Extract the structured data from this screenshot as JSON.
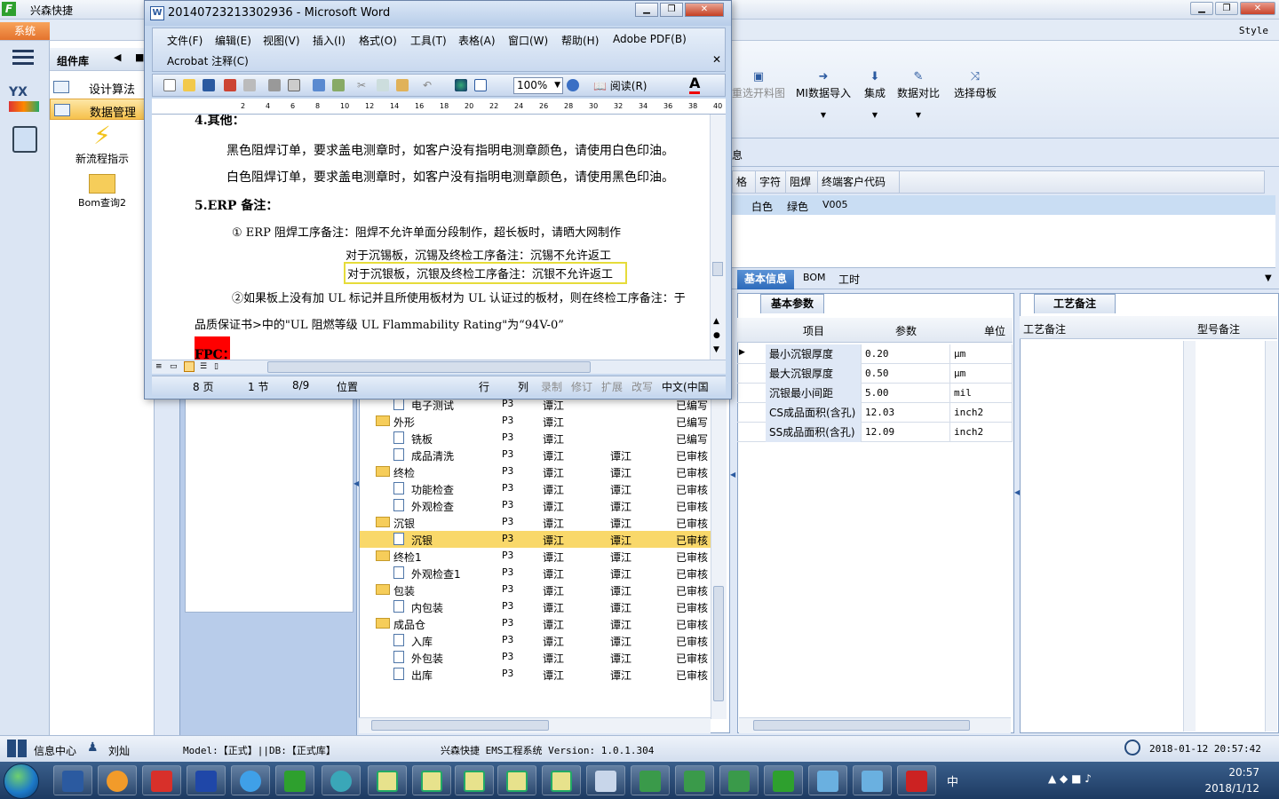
{
  "app": {
    "title": "兴森快捷",
    "logo": "F",
    "system_tab": "系统",
    "style_label": "Style"
  },
  "left_nav": {
    "panel_title": "组件库",
    "items": [
      {
        "label": "设计算法"
      },
      {
        "label": "数据管理"
      }
    ],
    "big_items": [
      {
        "label": "新流程指示"
      },
      {
        "label": "Bom查询2"
      }
    ]
  },
  "ribbon": {
    "buttons": [
      {
        "label": "重选开料图",
        "icon": "image-icon"
      },
      {
        "label": "MI数据导入",
        "icon": "import-icon"
      },
      {
        "label": "集成",
        "icon": "download-icon"
      },
      {
        "label": "数据对比",
        "icon": "compare-icon"
      },
      {
        "label": "选择母板",
        "icon": "shuffle-icon"
      }
    ]
  },
  "grid": {
    "headers": [
      "格",
      "字符",
      "阻焊",
      "终端客户代码"
    ],
    "row": [
      "白色",
      "绿色",
      "V005"
    ]
  },
  "info_tabs": [
    "基本信息",
    "BOM",
    "工时"
  ],
  "params": {
    "tab": "基本参数",
    "headers": [
      "项目",
      "参数",
      "单位"
    ],
    "rows": [
      {
        "name": "最小沉银厚度",
        "value": "0.20",
        "unit": "μm"
      },
      {
        "name": "最大沉银厚度",
        "value": "0.50",
        "unit": "μm"
      },
      {
        "name": "沉银最小间距",
        "value": "5.00",
        "unit": "mil"
      },
      {
        "name": "CS成品面积(含孔)",
        "value": "12.03",
        "unit": "inch2"
      },
      {
        "name": "SS成品面积(含孔)",
        "value": "12.09",
        "unit": "inch2"
      }
    ]
  },
  "process": {
    "tab": "工艺备注",
    "headers": [
      "工艺备注",
      "型号备注"
    ]
  },
  "tree": {
    "rows": [
      {
        "level": 1,
        "name": "电子测试",
        "c1": "P3",
        "c2": "谭江",
        "c3": "",
        "c4": "已编写"
      },
      {
        "level": 0,
        "name": "外形",
        "c1": "P3",
        "c2": "谭江",
        "c3": "",
        "c4": "已编写"
      },
      {
        "level": 1,
        "name": "铣板",
        "c1": "P3",
        "c2": "谭江",
        "c3": "",
        "c4": "已编写"
      },
      {
        "level": 1,
        "name": "成品清洗",
        "c1": "P3",
        "c2": "谭江",
        "c3": "谭江",
        "c4": "已审核"
      },
      {
        "level": 0,
        "name": "终检",
        "c1": "P3",
        "c2": "谭江",
        "c3": "谭江",
        "c4": "已审核"
      },
      {
        "level": 1,
        "name": "功能检查",
        "c1": "P3",
        "c2": "谭江",
        "c3": "谭江",
        "c4": "已审核"
      },
      {
        "level": 1,
        "name": "外观检查",
        "c1": "P3",
        "c2": "谭江",
        "c3": "谭江",
        "c4": "已审核"
      },
      {
        "level": 0,
        "name": "沉银",
        "c1": "P3",
        "c2": "谭江",
        "c3": "谭江",
        "c4": "已审核"
      },
      {
        "level": 1,
        "name": "沉银",
        "c1": "P3",
        "c2": "谭江",
        "c3": "谭江",
        "c4": "已审核",
        "selected": true
      },
      {
        "level": 0,
        "name": "终检1",
        "c1": "P3",
        "c2": "谭江",
        "c3": "谭江",
        "c4": "已审核"
      },
      {
        "level": 1,
        "name": "外观检查1",
        "c1": "P3",
        "c2": "谭江",
        "c3": "谭江",
        "c4": "已审核"
      },
      {
        "level": 0,
        "name": "包装",
        "c1": "P3",
        "c2": "谭江",
        "c3": "谭江",
        "c4": "已审核"
      },
      {
        "level": 1,
        "name": "内包装",
        "c1": "P3",
        "c2": "谭江",
        "c3": "谭江",
        "c4": "已审核"
      },
      {
        "level": 0,
        "name": "成品仓",
        "c1": "P3",
        "c2": "谭江",
        "c3": "谭江",
        "c4": "已审核"
      },
      {
        "level": 1,
        "name": "入库",
        "c1": "P3",
        "c2": "谭江",
        "c3": "谭江",
        "c4": "已审核"
      },
      {
        "level": 1,
        "name": "外包装",
        "c1": "P3",
        "c2": "谭江",
        "c3": "谭江",
        "c4": "已审核"
      },
      {
        "level": 1,
        "name": "出库",
        "c1": "P3",
        "c2": "谭江",
        "c3": "谭江",
        "c4": "已审核"
      }
    ]
  },
  "status": {
    "info_center": "信息中心",
    "user": "刘灿",
    "model": "Model:【正式】||DB:【正式库】",
    "system": "兴森快捷 EMS工程系统 Version: 1.0.1.304",
    "datetime": "2018-01-12 20:57:42"
  },
  "word": {
    "title": "20140723213302936 - Microsoft Word",
    "menu": [
      "文件(F)",
      "编辑(E)",
      "视图(V)",
      "插入(I)",
      "格式(O)",
      "工具(T)",
      "表格(A)",
      "窗口(W)",
      "帮助(H)",
      "Adobe PDF(B)"
    ],
    "menu2": "Acrobat 注释(C)",
    "zoom": "100%",
    "read_label": "阅读(R)",
    "ruler_marks": [
      "2",
      "4",
      "6",
      "8",
      "10",
      "12",
      "14",
      "16",
      "18",
      "20",
      "22",
      "24",
      "26",
      "28",
      "30",
      "32",
      "34",
      "36",
      "38",
      "40"
    ],
    "doc_lines": [
      "4.其他：",
      "黑色阻焊订单，要求盖电测章时，如客户没有指明电测章颜色，请使用白色印油。",
      "白色阻焊订单，要求盖电测章时，如客户没有指明电测章颜色，请使用黑色印油。",
      "5.ERP 备注：",
      "① ERP 阻焊工序备注：阻焊不允许单面分段制作，超长板时，请晒大网制作",
      "对于沉锡板，沉锡及终检工序备注：沉锡不允许返工",
      "对于沉银板，沉银及终检工序备注：沉银不允许返工",
      "②如果板上没有加 UL 标记并且所使用板材为 UL 认证过的板材，则在终检工序备注：于",
      "品质保证书>中的\"UL 阻燃等级 UL Flammability Rating\"为“94V-0”",
      "FPC："
    ],
    "status": {
      "page": "8 页",
      "section": "1 节",
      "pages": "8/9",
      "position": "位置",
      "line": "行",
      "col": "列",
      "rec": "录制",
      "rev": "修订",
      "ext": "扩展",
      "ovr": "改写",
      "lang": "中文(中国"
    }
  },
  "taskbar": {
    "time": "20:57",
    "date": "2018/1/12",
    "ime": "中"
  },
  "colors": {
    "accent": "#2e6bbb",
    "selection": "#f9d86a",
    "system_tab": "#e4722d",
    "highlight_box": "#e6dc3a",
    "fpc_red": "#ff0000"
  }
}
